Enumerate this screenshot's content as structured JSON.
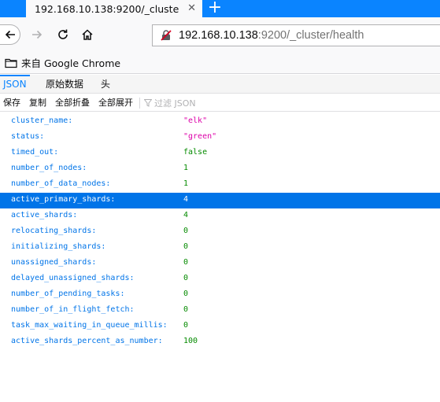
{
  "tab": {
    "title": "192.168.10.138:9200/_cluster/he",
    "close_icon": "close-icon"
  },
  "url": {
    "host": "192.168.10.138",
    "path": ":9200/_cluster/health"
  },
  "bookmarks": [
    {
      "label": "来自 Google Chrome",
      "icon": "folder-icon"
    }
  ],
  "viewer_tabs": {
    "json": "JSON",
    "raw": "原始数据",
    "headers": "头"
  },
  "toolbar": {
    "save": "保存",
    "copy": "复制",
    "collapse_all": "全部折叠",
    "expand_all": "全部展开",
    "filter_placeholder": "过滤 JSON"
  },
  "rows": [
    {
      "key": "cluster_name:",
      "value": "\"elk\"",
      "type": "string"
    },
    {
      "key": "status:",
      "value": "\"green\"",
      "type": "string"
    },
    {
      "key": "timed_out:",
      "value": "false",
      "type": "boolean"
    },
    {
      "key": "number_of_nodes:",
      "value": "1",
      "type": "number"
    },
    {
      "key": "number_of_data_nodes:",
      "value": "1",
      "type": "number"
    },
    {
      "key": "active_primary_shards:",
      "value": "4",
      "type": "number",
      "selected": true
    },
    {
      "key": "active_shards:",
      "value": "4",
      "type": "number"
    },
    {
      "key": "relocating_shards:",
      "value": "0",
      "type": "number"
    },
    {
      "key": "initializing_shards:",
      "value": "0",
      "type": "number"
    },
    {
      "key": "unassigned_shards:",
      "value": "0",
      "type": "number"
    },
    {
      "key": "delayed_unassigned_shards:",
      "value": "0",
      "type": "number"
    },
    {
      "key": "number_of_pending_tasks:",
      "value": "0",
      "type": "number"
    },
    {
      "key": "number_of_in_flight_fetch:",
      "value": "0",
      "type": "number"
    },
    {
      "key": "task_max_waiting_in_queue_millis:",
      "value": "0",
      "type": "number"
    },
    {
      "key": "active_shards_percent_as_number:",
      "value": "100",
      "type": "number"
    }
  ],
  "colors": {
    "accent": "#0a84ff",
    "selected_row": "#0074e8",
    "key": "#0074e8",
    "string": "#dd00a9",
    "number": "#058b00"
  }
}
